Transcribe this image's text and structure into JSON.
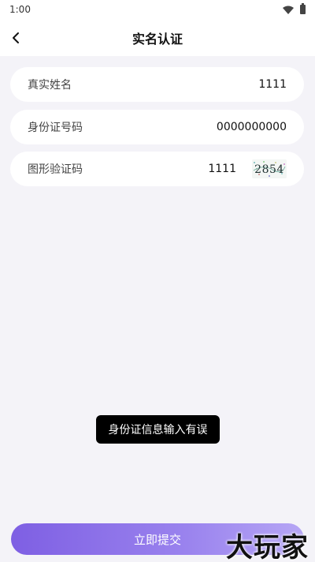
{
  "status_bar": {
    "time": "1:00",
    "icons": [
      "wifi-icon",
      "battery-icon"
    ]
  },
  "header": {
    "title": "实名认证",
    "back_icon": "chevron-left-icon"
  },
  "form": {
    "name": {
      "label": "真实姓名",
      "value": "1111"
    },
    "id_number": {
      "label": "身份证号码",
      "value": "0000000000"
    },
    "captcha": {
      "label": "图形验证码",
      "value": "1111",
      "image_text": "2854"
    }
  },
  "toast": {
    "message": "身份证信息输入有误"
  },
  "submit": {
    "label": "立即提交"
  },
  "watermark": {
    "text": "大玩家"
  },
  "colors": {
    "background": "#f4f3f8",
    "card": "#ffffff",
    "accent_start": "#7e5fe3",
    "accent_end": "#b6a6f5",
    "toast_bg": "#000000"
  }
}
